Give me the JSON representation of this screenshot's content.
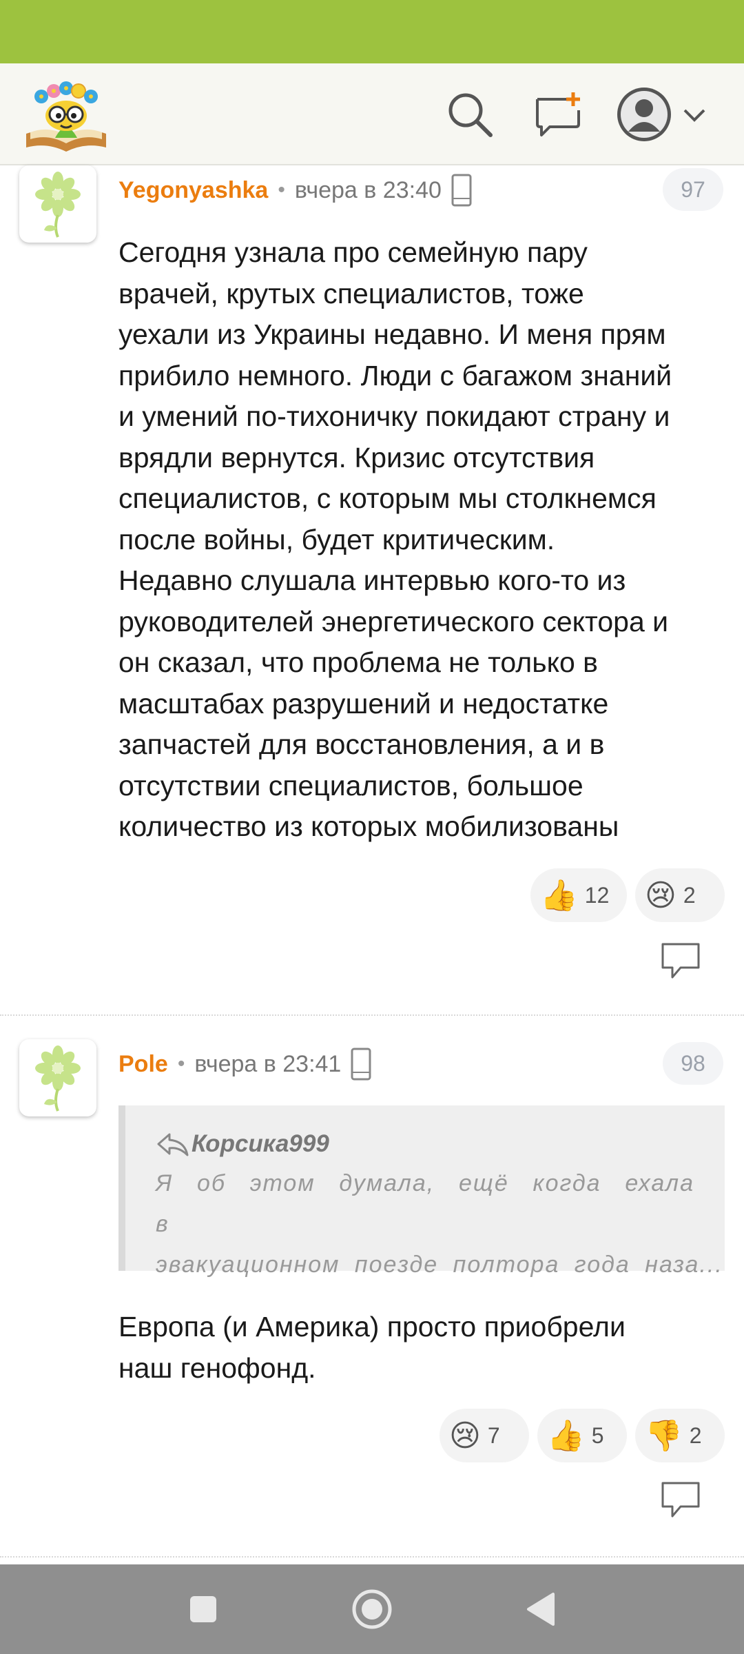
{
  "colors": {
    "status_bar": "#9dc23f",
    "author": "#eb7d0f",
    "header_bg": "#f7f7f2",
    "nav_bar": "#8f8f8f"
  },
  "header": {
    "logo_icon": "flower-book-logo-icon",
    "search_icon": "search-icon",
    "new_post_icon": "new-post-icon",
    "profile_icon": "profile-avatar-icon",
    "dropdown_icon": "chevron-down-icon"
  },
  "comments": [
    {
      "author": "Yegonyashka",
      "separator": "•",
      "time": "вчера в 23:40",
      "device_icon": "mobile-phone-icon",
      "number": "97",
      "text_lines": [
        "Сегодня узнала про семейную пару",
        "врачей, крутых специалистов, тоже",
        "уехали из Украины недавно. И меня прям",
        "прибило немного. Люди с багажом знаний",
        "и умений по-тихоничку покидают страну и",
        "врядли вернутся. Кризис отсутствия",
        "специалистов, с которым мы столкнемся",
        "после войны, будет критическим.",
        "Недавно слушала интервью кого-то из",
        "руководителей энергетического сектора и",
        "он сказал, что проблема не только в",
        "масштабах разрушений и недостатке",
        "запчастей для восстановления, а и в",
        "отсутствии специалистов, большое",
        "количество из которых мобилизованы"
      ],
      "reactions": [
        {
          "emoji": "👍",
          "icon": "thumbs-up-icon",
          "count": "12"
        },
        {
          "emoji": "😢",
          "icon": "crying-face-icon",
          "count": "2"
        }
      ]
    },
    {
      "author": "Pole",
      "separator": "•",
      "time": "вчера в 23:41",
      "device_icon": "mobile-phone-icon",
      "number": "98",
      "quote": {
        "author": "Корсика999",
        "line1": "Я об этом думала, ещё когда ехала в",
        "line2": "эвакуационном поезде полтора года наза..."
      },
      "text_lines": [
        "Европа (и Америка) просто приобрели",
        "наш генофонд."
      ],
      "reactions": [
        {
          "emoji": "😢",
          "icon": "crying-face-icon",
          "count": "7"
        },
        {
          "emoji": "👍",
          "icon": "thumbs-up-icon",
          "count": "5"
        },
        {
          "emoji": "👎",
          "icon": "thumbs-down-icon",
          "count": "2"
        }
      ]
    }
  ],
  "navbar": {
    "recents_icon": "recents-square-icon",
    "home_icon": "home-circle-icon",
    "back_icon": "back-triangle-icon"
  }
}
